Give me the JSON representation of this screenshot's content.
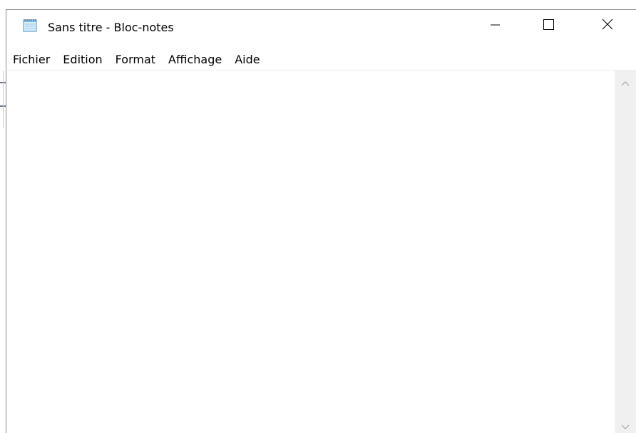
{
  "window": {
    "title": "Sans titre - Bloc-notes",
    "app_icon": "notepad-icon"
  },
  "controls": {
    "minimize_icon": "minimize-icon",
    "maximize_icon": "maximize-icon",
    "close_icon": "close-icon"
  },
  "menu": {
    "items": [
      {
        "label": "Fichier"
      },
      {
        "label": "Edition"
      },
      {
        "label": "Format"
      },
      {
        "label": "Affichage"
      },
      {
        "label": "Aide"
      }
    ]
  },
  "editor": {
    "content": ""
  },
  "scrollbar": {
    "up_icon": "chevron-up-icon",
    "down_icon": "chevron-down-icon"
  },
  "colors": {
    "titlebar_bg": "#ffffff",
    "scrollbar_bg": "#f0f0f0",
    "window_border": "#8a8a8a"
  }
}
